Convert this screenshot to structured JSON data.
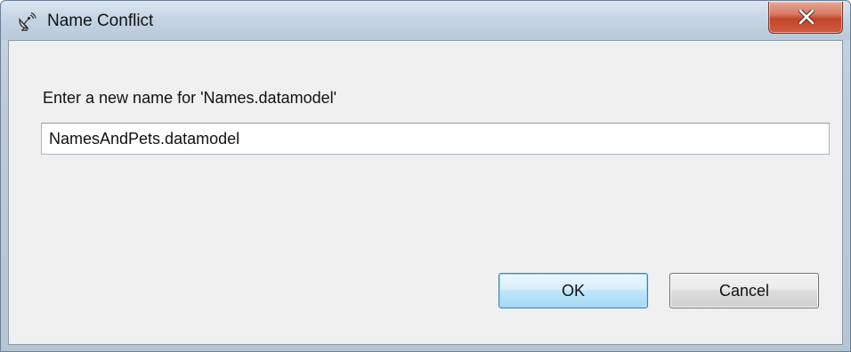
{
  "window": {
    "title": "Name Conflict",
    "title_icon": "satellite-dish-icon",
    "close_icon": "close-x-icon"
  },
  "dialog": {
    "prompt": "Enter a new name for 'Names.datamodel'",
    "name_value": "NamesAndPets.datamodel"
  },
  "buttons": {
    "ok_label": "OK",
    "cancel_label": "Cancel"
  },
  "colors": {
    "close_button": "#c2452b",
    "default_button": "#bee6fd",
    "dialog_background": "#f0f0f0"
  }
}
